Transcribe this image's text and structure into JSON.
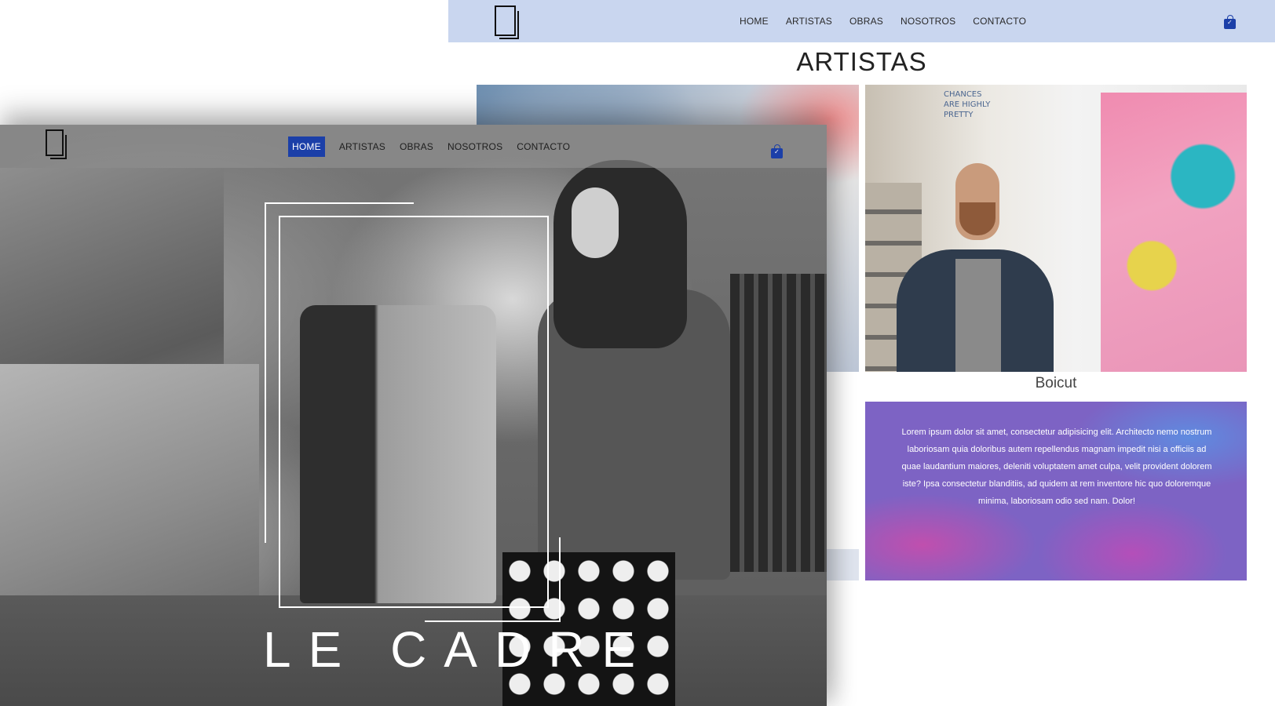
{
  "back_window": {
    "nav": [
      "HOME",
      "ARTISTAS",
      "OBRAS",
      "NOSOTROS",
      "CONTACTO"
    ],
    "page_title": "ARTISTAS",
    "artist": {
      "name": "Boicut",
      "wall_text": "CHANCES ARE HIGHLY PRETTY",
      "bio": "Lorem ipsum dolor sit amet, consectetur adipisicing elit. Architecto nemo nostrum laboriosam quia doloribus autem repellendus magnam impedit nisi a officiis ad quae laudantium maiores, deleniti voluptatem amet culpa, velit provident dolorem iste? Ipsa consectetur blanditiis, ad quidem at rem inventore hic quo doloremque minima, laboriosam odio sed nam. Dolor!"
    }
  },
  "front_window": {
    "nav": [
      "HOME",
      "ARTISTAS",
      "OBRAS",
      "NOSOTROS",
      "CONTACTO"
    ],
    "active_nav": "HOME",
    "brand": "LE CADRE"
  },
  "colors": {
    "accent": "#1b3fa8",
    "back_header": "#c9d6ef",
    "bio_box": "#7d63c4"
  },
  "icons": {
    "logo": "frame-logo-icon",
    "cart": "shopping-bag-icon"
  }
}
